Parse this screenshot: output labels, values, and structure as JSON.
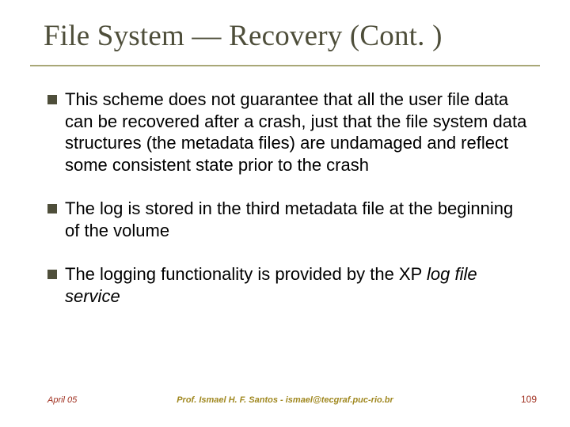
{
  "title": "File System — Recovery (Cont. )",
  "bullets": [
    {
      "text": "This scheme does not guarantee that all the user file data can be recovered after a crash, just that the file system data structures (the metadata files) are undamaged and reflect some consistent state prior to the crash"
    },
    {
      "text": "The log is stored in the third metadata file at the beginning of the volume"
    },
    {
      "prefix": "The logging functionality is provided by the XP ",
      "italic": "log file service"
    }
  ],
  "footer": {
    "left": "April 05",
    "center": "Prof. Ismael H. F. Santos  -  ismael@tecgraf.puc-rio.br",
    "right": "109"
  }
}
